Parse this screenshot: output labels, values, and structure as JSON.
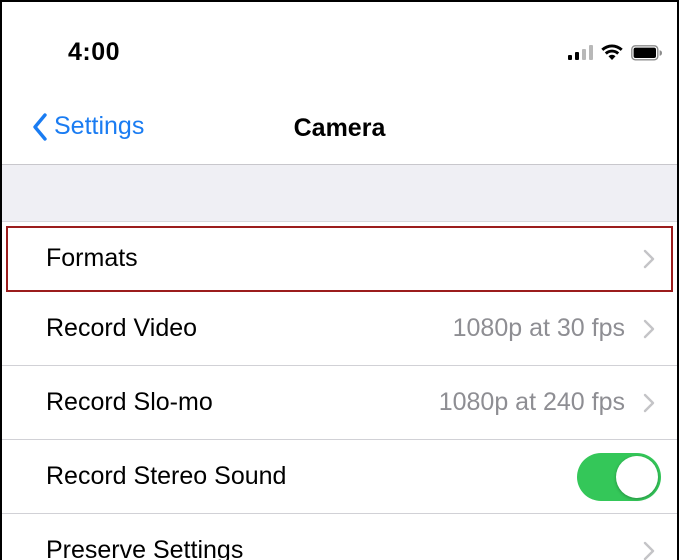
{
  "status_bar": {
    "time": "4:00",
    "icons": [
      "cellular-signal-icon",
      "wifi-icon",
      "battery-icon"
    ]
  },
  "nav": {
    "back_label": "Settings",
    "title": "Camera"
  },
  "rows": [
    {
      "label": "Formats",
      "value": "",
      "accessory": "chevron",
      "highlighted": true
    },
    {
      "label": "Record Video",
      "value": "1080p at 30 fps",
      "accessory": "chevron"
    },
    {
      "label": "Record Slo-mo",
      "value": "1080p at 240 fps",
      "accessory": "chevron"
    },
    {
      "label": "Record Stereo Sound",
      "value": "",
      "accessory": "toggle",
      "toggle_on": true
    },
    {
      "label": "Preserve Settings",
      "value": "",
      "accessory": "chevron"
    }
  ],
  "colors": {
    "accent": "#1a7cf2",
    "toggle_on": "#34c759",
    "highlight_border": "#9b1c1c",
    "secondary_text": "#8e8e93",
    "group_background": "#efeff4"
  }
}
